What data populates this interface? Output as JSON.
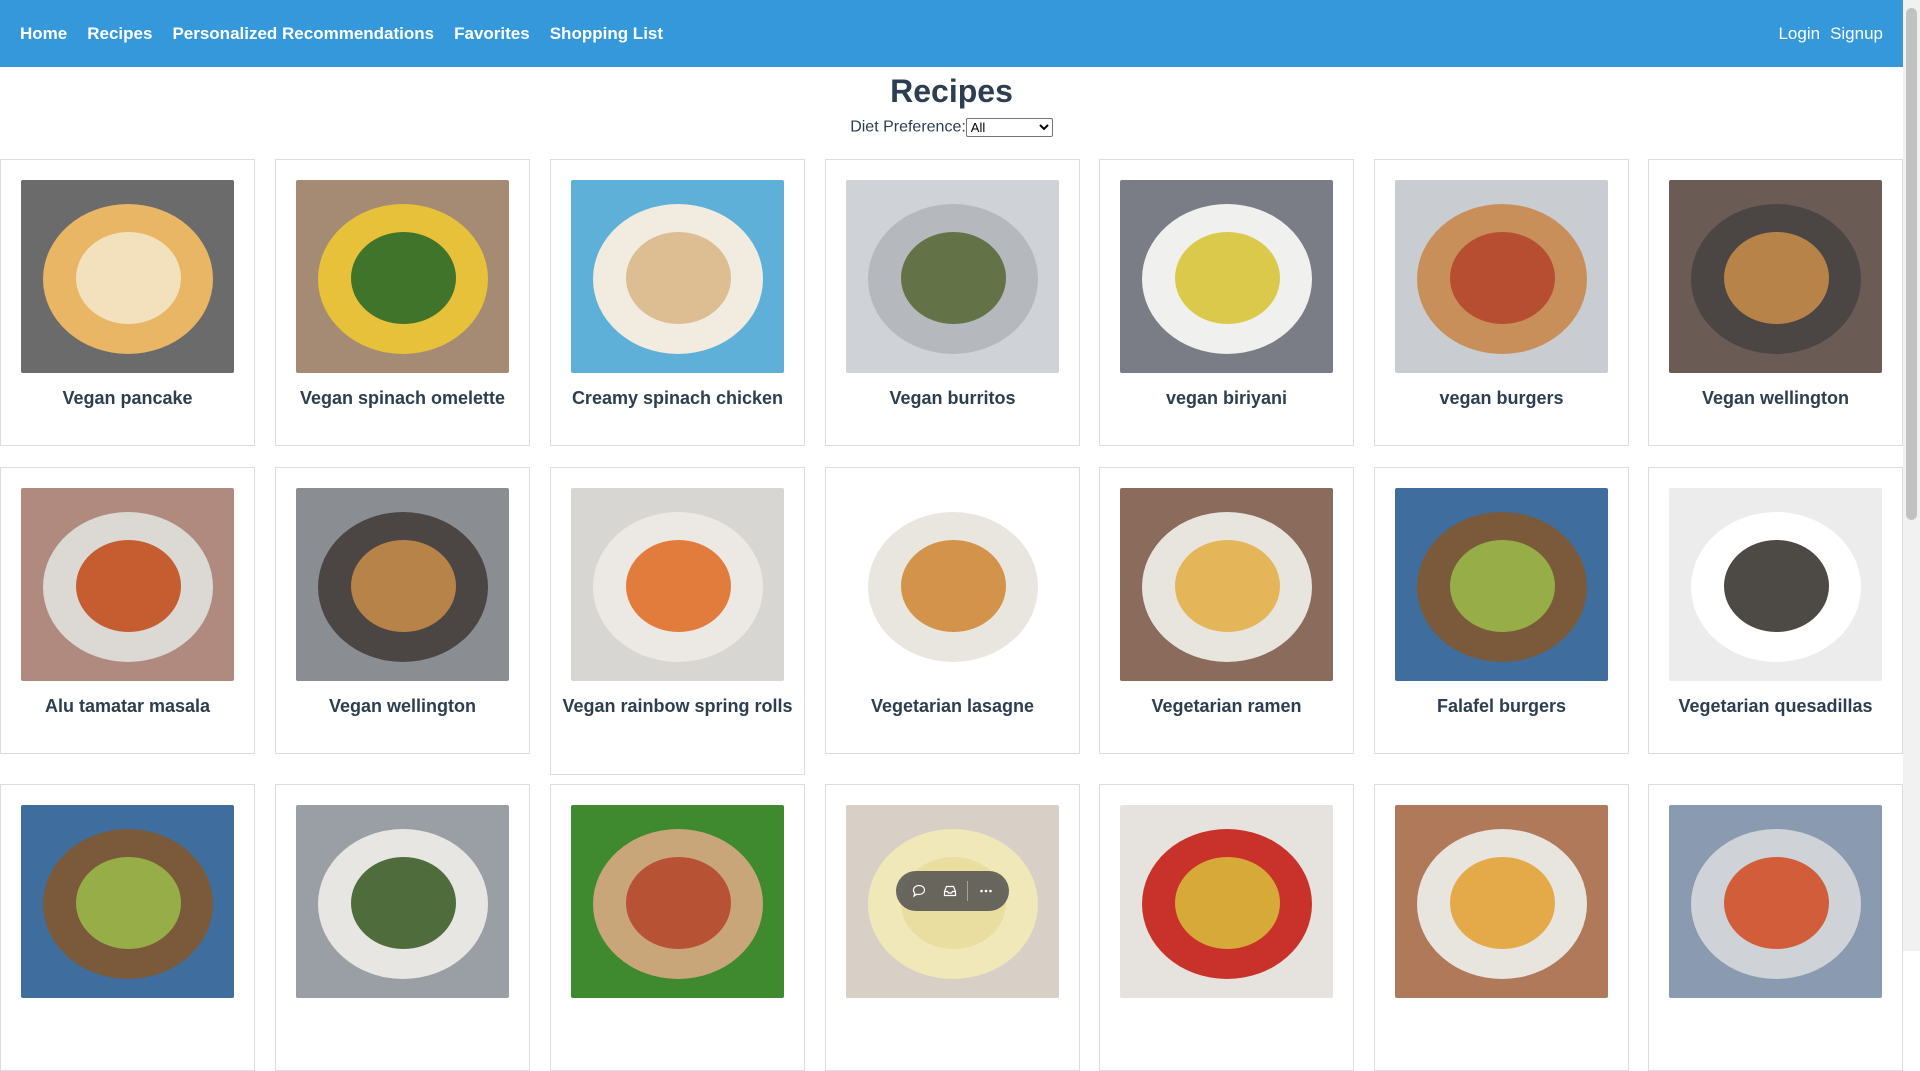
{
  "nav": {
    "left": [
      "Home",
      "Recipes",
      "Personalized Recommendations",
      "Favorites",
      "Shopping List"
    ],
    "right": [
      "Login",
      "Signup"
    ]
  },
  "page": {
    "title": "Recipes",
    "diet_label": "Diet Preference:",
    "diet_selected": "All"
  },
  "recipes": [
    {
      "name": "Vegan pancake",
      "colors": [
        "#6b6b6b",
        "#e8b665",
        "#f3e6c5"
      ]
    },
    {
      "name": "Vegan spinach omelette",
      "colors": [
        "#a58b74",
        "#e8c13a",
        "#2f6b2a"
      ]
    },
    {
      "name": "Creamy spinach chicken",
      "colors": [
        "#5fb0d8",
        "#f2ece0",
        "#d9b98a"
      ]
    },
    {
      "name": "Vegan burritos",
      "colors": [
        "#cfd2d6",
        "#b5b8bd",
        "#5a6b3a"
      ]
    },
    {
      "name": "vegan biriyani",
      "colors": [
        "#7b7d86",
        "#f0f0ee",
        "#d8c43a"
      ]
    },
    {
      "name": "vegan burgers",
      "colors": [
        "#c9ccd0",
        "#c98f5a",
        "#b5472c"
      ]
    },
    {
      "name": "Vegan wellington",
      "colors": [
        "#6b5b55",
        "#4b4644",
        "#c48a4a"
      ]
    },
    {
      "name": "Alu tamatar masala",
      "colors": [
        "#b08a7e",
        "#dcd8d4",
        "#c2501f"
      ]
    },
    {
      "name": "Vegan wellington",
      "colors": [
        "#8a8e93",
        "#4b4644",
        "#c48a4a"
      ]
    },
    {
      "name": "Vegan rainbow spring rolls",
      "colors": [
        "#d8d6d2",
        "#ece9e4",
        "#e0702a"
      ]
    },
    {
      "name": "Vegetarian lasagne",
      "colors": [
        "#ffffff",
        "#e9e6e0",
        "#d08a3a"
      ]
    },
    {
      "name": "Vegetarian ramen",
      "colors": [
        "#8b6b5b",
        "#e8e4de",
        "#e3b04a"
      ]
    },
    {
      "name": "Falafel burgers",
      "colors": [
        "#3f6e9e",
        "#7a5a3a",
        "#9ab74a"
      ]
    },
    {
      "name": "Vegetarian quesadillas",
      "colors": [
        "#ececec",
        "#ffffff",
        "#3a3530"
      ]
    },
    {
      "name": "",
      "colors": [
        "#3f6e9e",
        "#7a5a3a",
        "#9ab74a"
      ]
    },
    {
      "name": "",
      "colors": [
        "#9a9fa6",
        "#e8e6e2",
        "#3e5e2a"
      ]
    },
    {
      "name": "",
      "colors": [
        "#3f8a2e",
        "#c9a57a",
        "#b54a2c"
      ]
    },
    {
      "name": "",
      "colors": [
        "#d8cfc6",
        "#f0e8b8",
        "#e8dc9c"
      ]
    },
    {
      "name": "",
      "colors": [
        "#e6e3de",
        "#c8322a",
        "#d8b63a"
      ]
    },
    {
      "name": "",
      "colors": [
        "#b07a5a",
        "#e8e4de",
        "#e3a33a"
      ]
    },
    {
      "name": "",
      "colors": [
        "#8a9ab0",
        "#cfd3d8",
        "#d0502a"
      ]
    }
  ],
  "toolbar": [
    "chat-icon",
    "inbox-icon",
    "more-icon"
  ],
  "colors": {
    "navbar": "#3498db",
    "text": "#2c3e50"
  }
}
